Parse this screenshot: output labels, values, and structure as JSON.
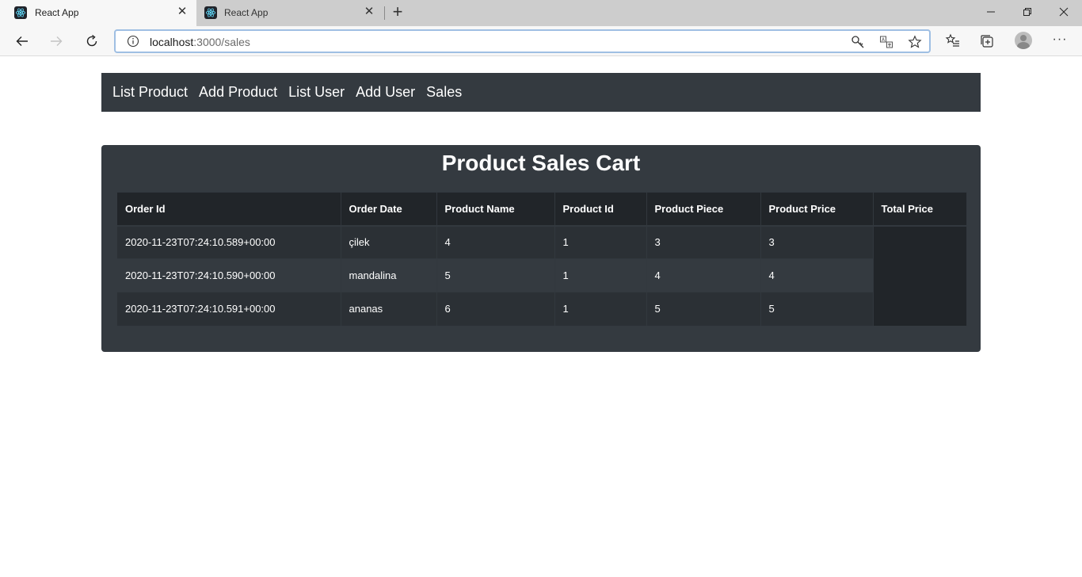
{
  "browser": {
    "tabs": [
      {
        "title": "React App",
        "active": true
      },
      {
        "title": "React App",
        "active": false
      }
    ],
    "url": {
      "host": "localhost",
      "path": ":3000/sales"
    }
  },
  "nav": {
    "items": [
      "List Product",
      "Add Product",
      "List User",
      "Add User",
      "Sales"
    ]
  },
  "page": {
    "title": "Product Sales Cart"
  },
  "table": {
    "headers": [
      "Order Id",
      "Order Date",
      "Product Name",
      "Product Id",
      "Product Piece",
      "Product Price",
      "Total Price"
    ],
    "rows": [
      [
        "2020-11-23T07:24:10.589+00:00",
        "çilek",
        "4",
        "1",
        "3",
        "3"
      ],
      [
        "2020-11-23T07:24:10.590+00:00",
        "mandalina",
        "5",
        "1",
        "4",
        "4"
      ],
      [
        "2020-11-23T07:24:10.591+00:00",
        "ananas",
        "6",
        "1",
        "5",
        "5"
      ]
    ]
  },
  "colors": {
    "navbar_bg": "#343a40",
    "table_head_bg": "#212529",
    "row_odd_bg": "#2b3035",
    "text": "#ffffff"
  }
}
